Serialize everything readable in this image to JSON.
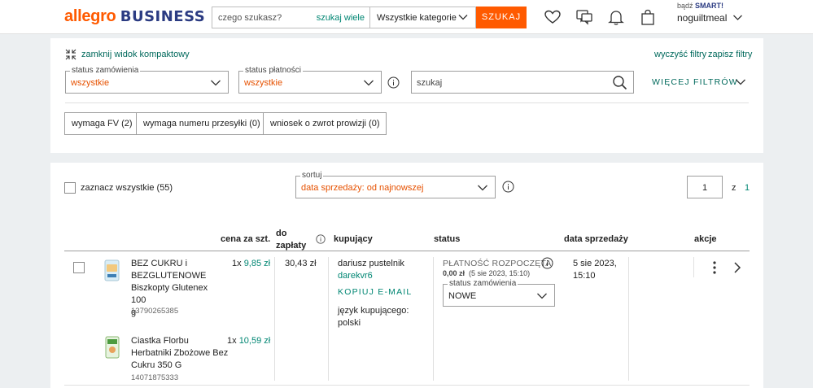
{
  "header": {
    "logo_allegro": "allegro",
    "logo_business": "BUSINESS",
    "search_placeholder": "czego szukasz?",
    "search_many": "szukaj wiele",
    "category": "Wszystkie kategorie",
    "search_button": "SZUKAJ",
    "smart_prefix": "bądź",
    "smart_label": "SMART!",
    "username": "noguiltmeal"
  },
  "filters": {
    "collapse_label": "zamknij widok kompaktowy",
    "clear_label": "wyczyść filtry",
    "save_label": "zapisz filtry",
    "order_status_label": "status zamówienia",
    "order_status_value": "wszystkie",
    "payment_status_label": "status płatności",
    "payment_status_value": "wszystkie",
    "search_placeholder": "szukaj",
    "more_filters": "WIĘCEJ FILTRÓW",
    "chips": [
      "wymaga FV (2)",
      "wymaga numeru przesyłki (0)",
      "wniosek o zwrot prowizji (0)"
    ]
  },
  "list": {
    "select_all": "zaznacz wszystkie (55)",
    "sort_label": "sortuj",
    "sort_value": "data sprzedaży: od najnowszej",
    "page_current": "1",
    "page_of": "z",
    "page_total": "1",
    "columns": {
      "price": "cena za szt.",
      "to_pay_1": "do",
      "to_pay_2": "zapłaty",
      "buyer": "kupujący",
      "status": "status",
      "sale_date": "data sprzedaży",
      "actions": "akcje"
    },
    "order": {
      "items": [
        {
          "name_lines": [
            "BEZ CUKRU i",
            "BEZGLUTENOWE",
            "Biszkopty Glutenex 100",
            "g"
          ],
          "id": "13790265385",
          "qty": "1x",
          "price": "9,85 zł"
        },
        {
          "name_lines": [
            "Ciastka Florbu",
            "Herbatniki Zbożowe Bez",
            "Cukru 350 G"
          ],
          "id": "14071875333",
          "qty": "1x",
          "price": "10,59 zł"
        }
      ],
      "total": "30,43 zł",
      "buyer_name": "dariusz pustelnik",
      "buyer_login": "darekvr6",
      "copy_email": "KOPIUJ E-MAIL",
      "buyer_lang_1": "język kupującego:",
      "buyer_lang_2": "polski",
      "payment_status": "PŁATNOŚĆ ROZPOCZĘTA",
      "payment_amount": "0,00 zł",
      "payment_date": "(5 sie 2023, 15:10)",
      "order_status_label": "status zamówienia",
      "order_status_value": "NOWE",
      "sale_date_1": "5 sie 2023,",
      "sale_date_2": "15:10"
    }
  }
}
